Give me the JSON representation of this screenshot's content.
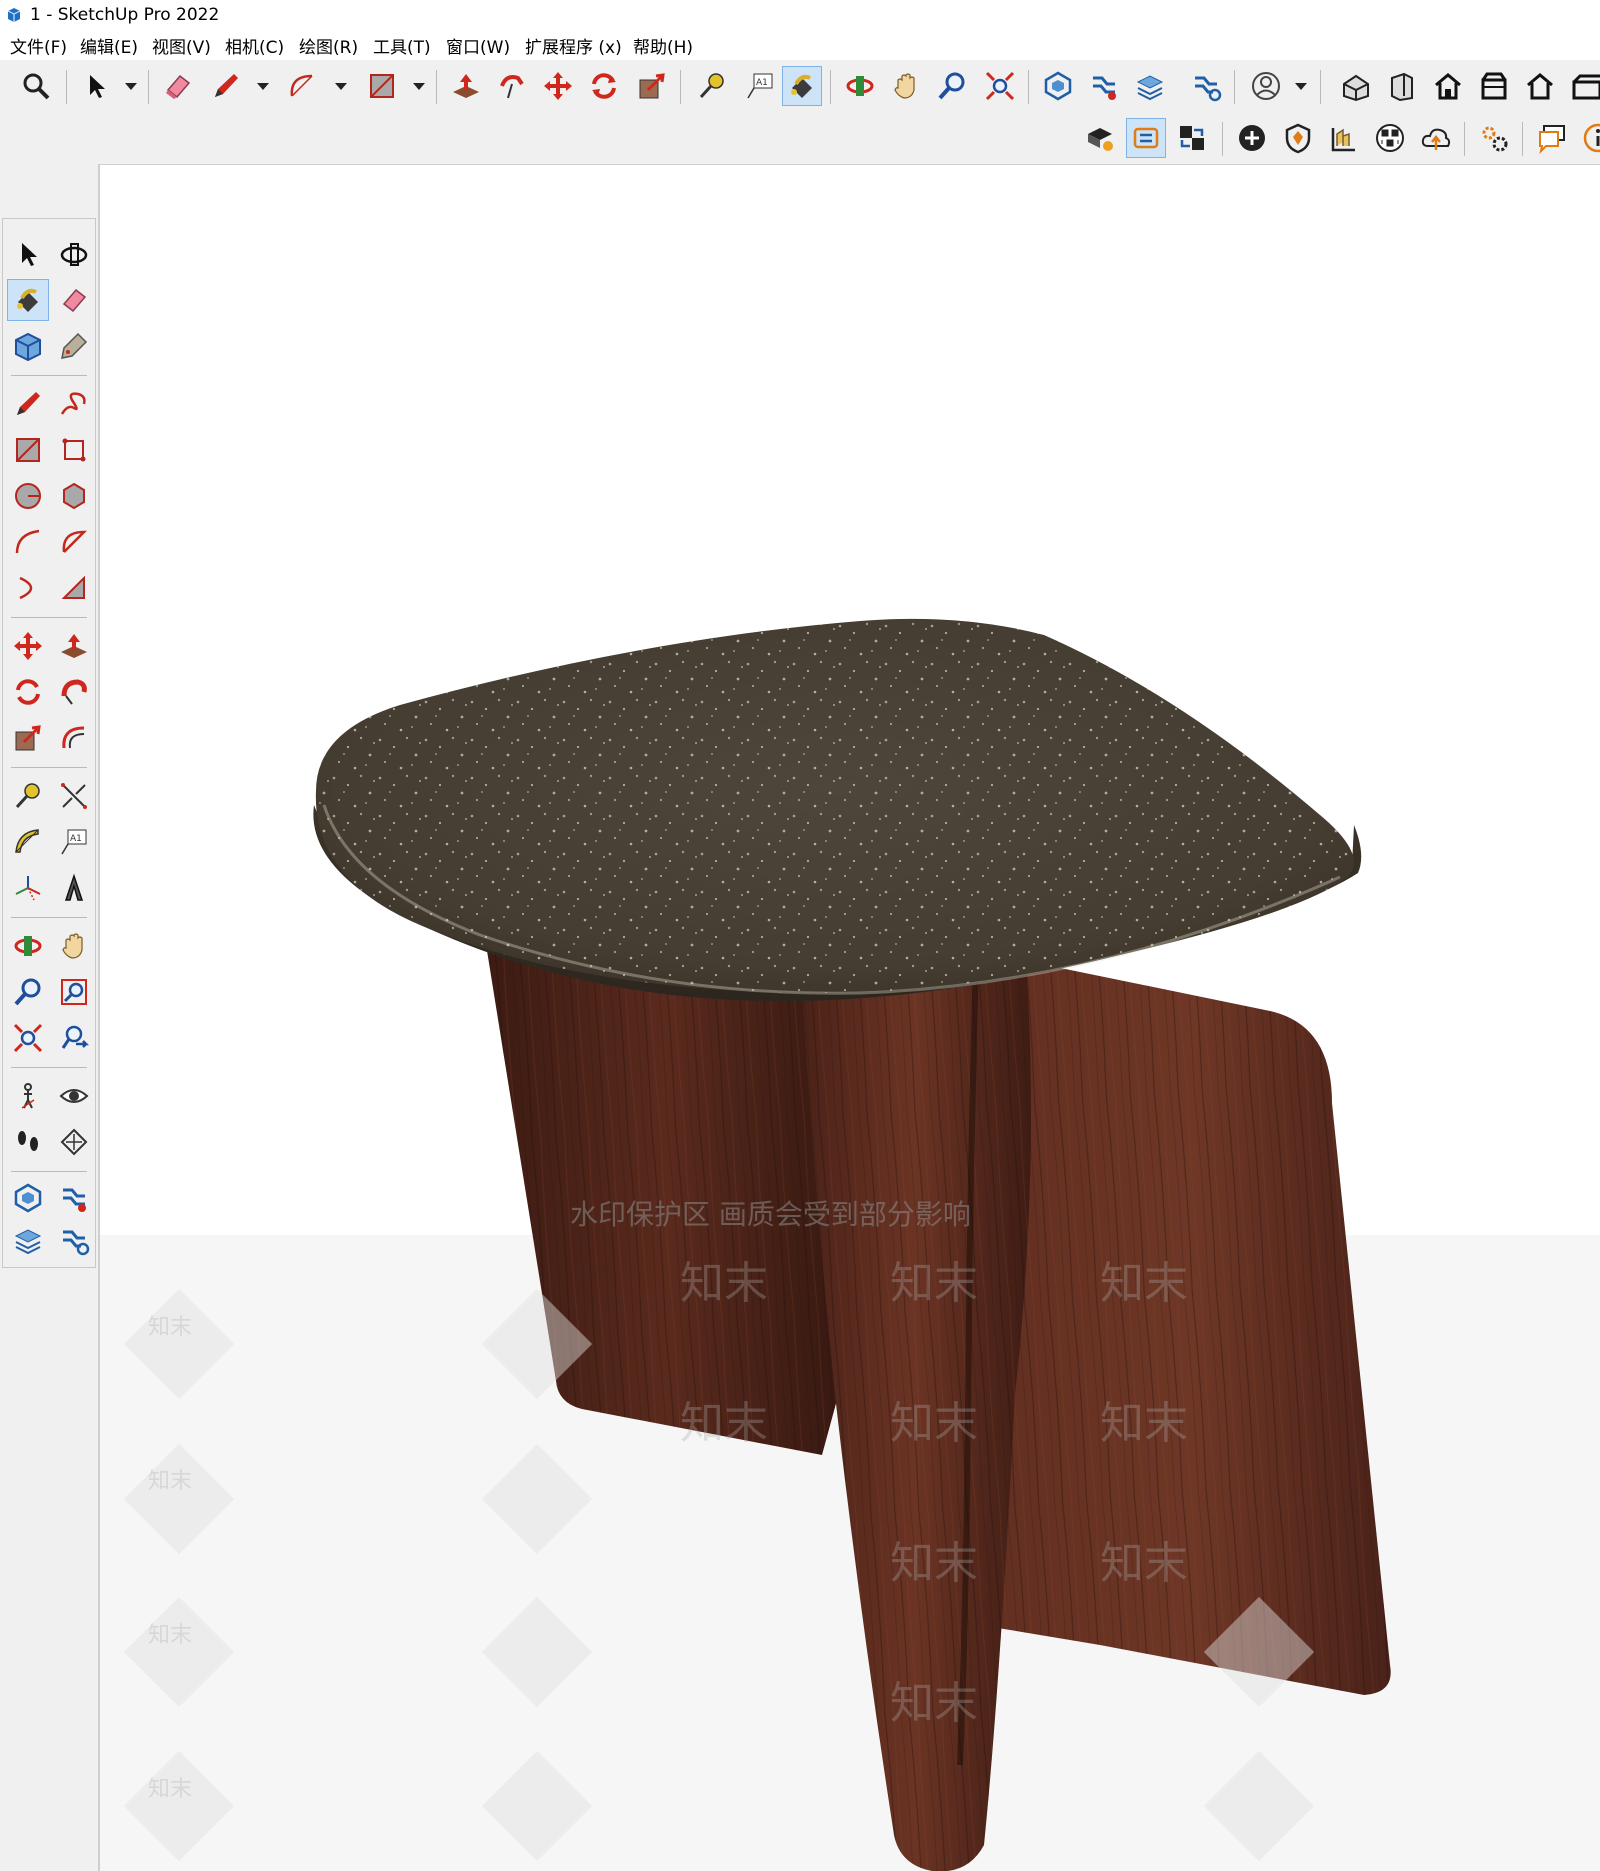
{
  "window": {
    "title": "1 - SketchUp Pro 2022"
  },
  "menu": [
    "文件(F)",
    "编辑(E)",
    "视图(V)",
    "相机(C)",
    "绘图(R)",
    "工具(T)",
    "窗口(W)",
    "扩展程序 (x)",
    "帮助(H)"
  ],
  "toolbar_row1": [
    "search-icon",
    "select-icon",
    "eraser-icon",
    "pencil-icon",
    "arc-icon",
    "rectangle-icon",
    "push-pull-icon",
    "follow-me-icon",
    "move-icon",
    "rotate-icon",
    "scale-icon",
    "tape-measure-icon",
    "text-icon",
    "paint-bucket-icon",
    "orbit-icon",
    "pan-icon",
    "zoom-icon",
    "zoom-extents-icon",
    "3d-warehouse-icon",
    "extension-warehouse-icon",
    "layout-icon",
    "extension-manager-icon",
    "account-icon",
    "iso-view-icon",
    "top-view-icon",
    "front-view-icon",
    "right-view-icon",
    "back-view-icon",
    "left-view-icon"
  ],
  "toolbar_row2": [
    "styles-icon",
    "trimble-connect-icon",
    "share-model-icon",
    "add-location-icon",
    "shield-icon",
    "sandbox-icon",
    "checker-icon",
    "cloud-upload-icon",
    "settings-gears-icon",
    "comment-icon",
    "info-icon"
  ],
  "left_toolbar": [
    "select-icon",
    "orbit-icon",
    "paint-bucket-icon",
    "eraser-icon",
    "component-icon",
    "tag-icon",
    "pencil-icon",
    "freehand-icon",
    "rectangle-icon",
    "rotated-rectangle-icon",
    "circle-icon",
    "polygon-icon",
    "arc-icon",
    "pie-icon",
    "two-point-arc-icon",
    "three-point-arc-icon",
    "move-icon",
    "push-pull-icon",
    "rotate-icon",
    "follow-me-icon",
    "scale-icon",
    "offset-icon",
    "tape-measure-icon",
    "dimension-icon",
    "protractor-icon",
    "text-icon",
    "axes-icon",
    "3d-text-icon",
    "orbit-icon",
    "pan-icon",
    "zoom-icon",
    "zoom-window-icon",
    "zoom-extents-icon",
    "previous-view-icon",
    "position-camera-icon",
    "look-around-icon",
    "walk-icon",
    "section-plane-icon",
    "3d-warehouse-icon",
    "extension-warehouse-icon",
    "layout-icon",
    "extension-manager-icon"
  ],
  "watermark": {
    "notice": "水印保护区  画质会受到部分影响",
    "text": "知末"
  },
  "colors": {
    "seat": "#4b4236",
    "wood": "#5a2c1f",
    "active_button": "#cde3f7"
  }
}
